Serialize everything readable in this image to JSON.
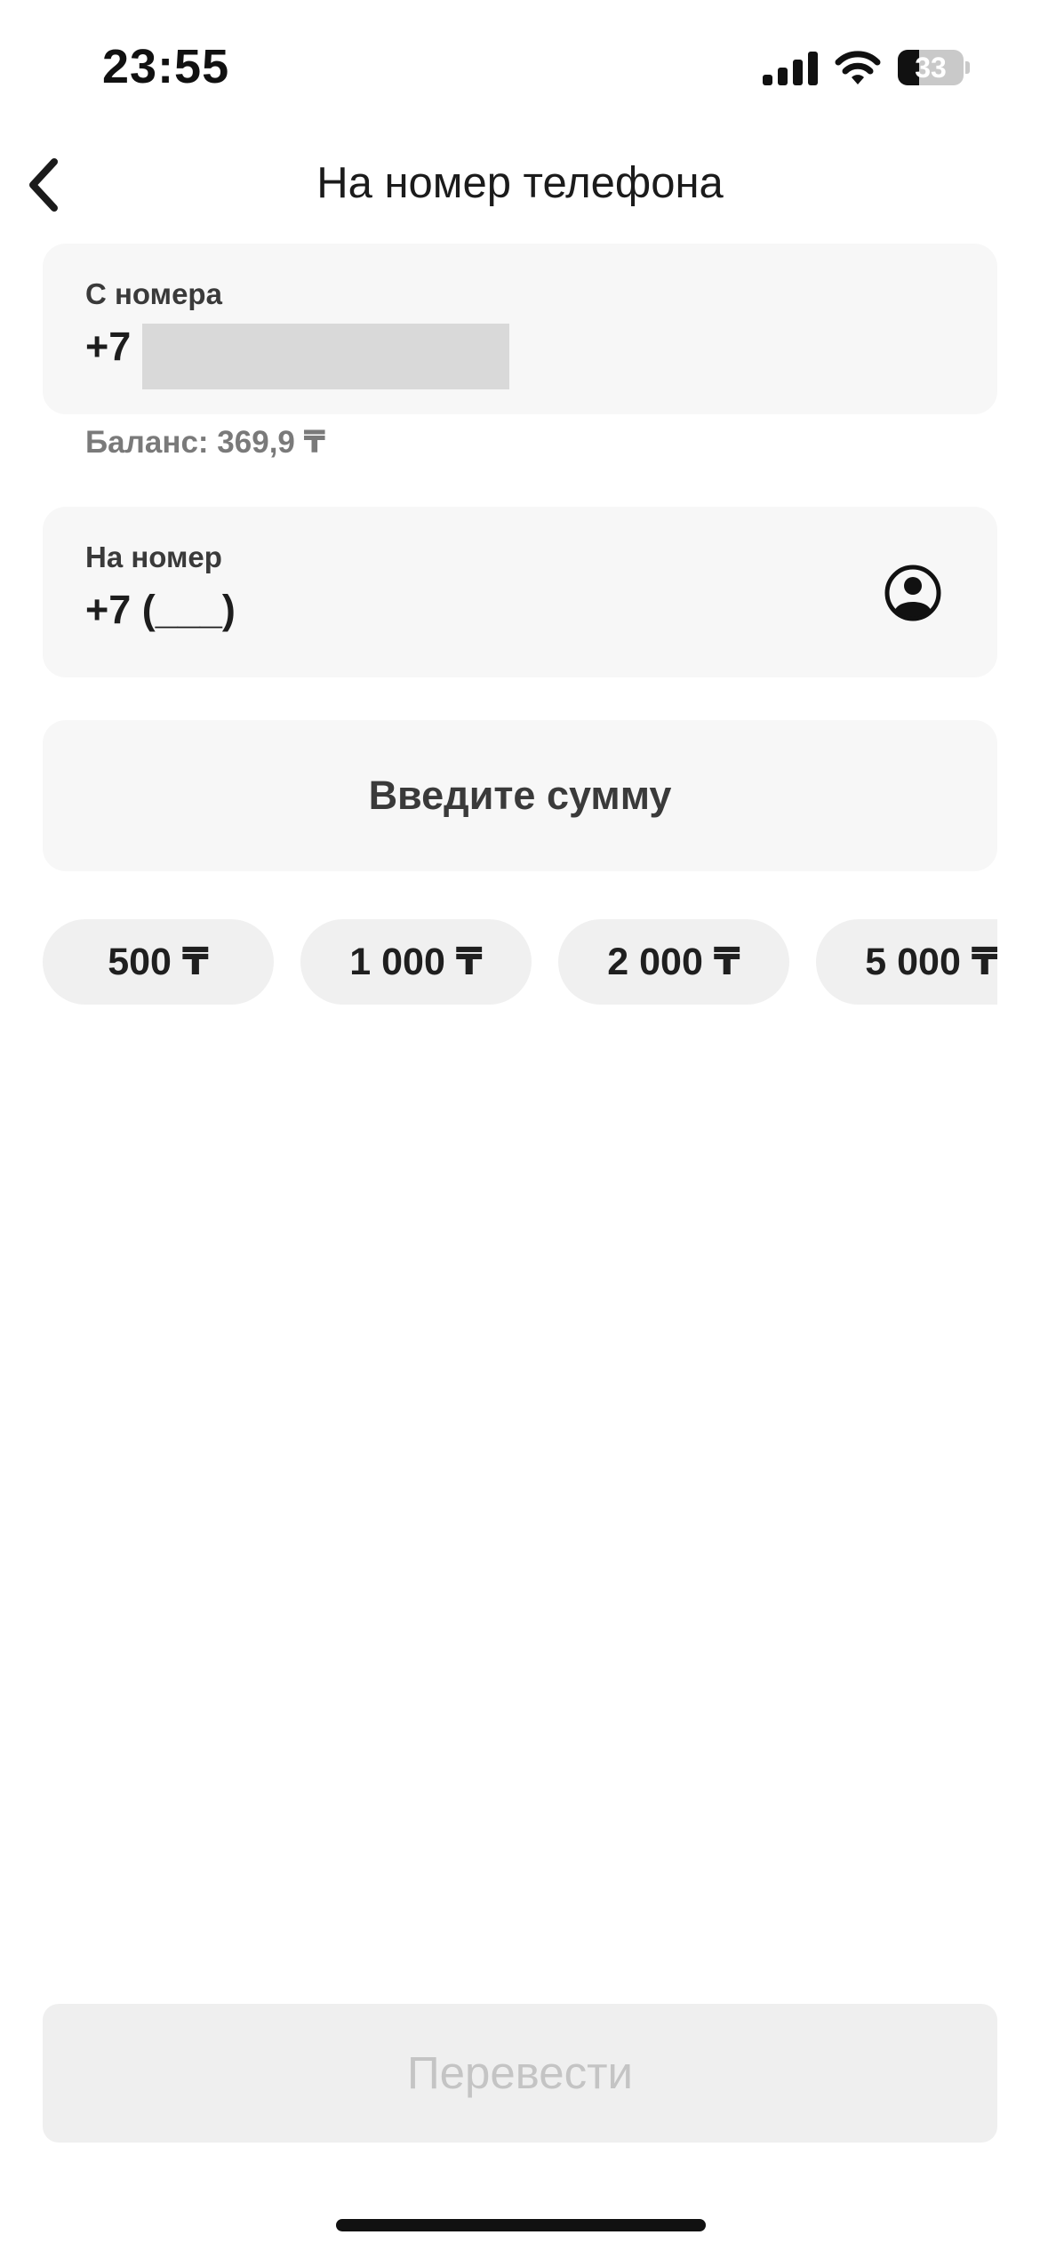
{
  "status_bar": {
    "time": "23:55",
    "battery_level": "33",
    "icons": [
      "signal-icon",
      "wifi-icon",
      "battery-icon"
    ]
  },
  "header": {
    "title": "На номер телефона",
    "back_icon": "chevron-left-icon"
  },
  "from_card": {
    "label": "С номера",
    "prefix": "+7",
    "balance": "Баланс: 369,9 ₸"
  },
  "to_card": {
    "label": "На номер",
    "value": "+7 (___)",
    "contacts_icon": "person-circle-icon"
  },
  "amount": {
    "placeholder": "Введите сумму"
  },
  "quick_amounts": [
    "500 ₸",
    "1 000 ₸",
    "2 000 ₸",
    "5 000 ₸"
  ],
  "transfer_button": {
    "label": "Перевести",
    "enabled": false
  },
  "colors": {
    "background": "#ffffff",
    "card": "#f7f7f7",
    "chip": "#f0f0f0",
    "disabled_button": "#efefef",
    "disabled_text": "#c4c4c4"
  }
}
